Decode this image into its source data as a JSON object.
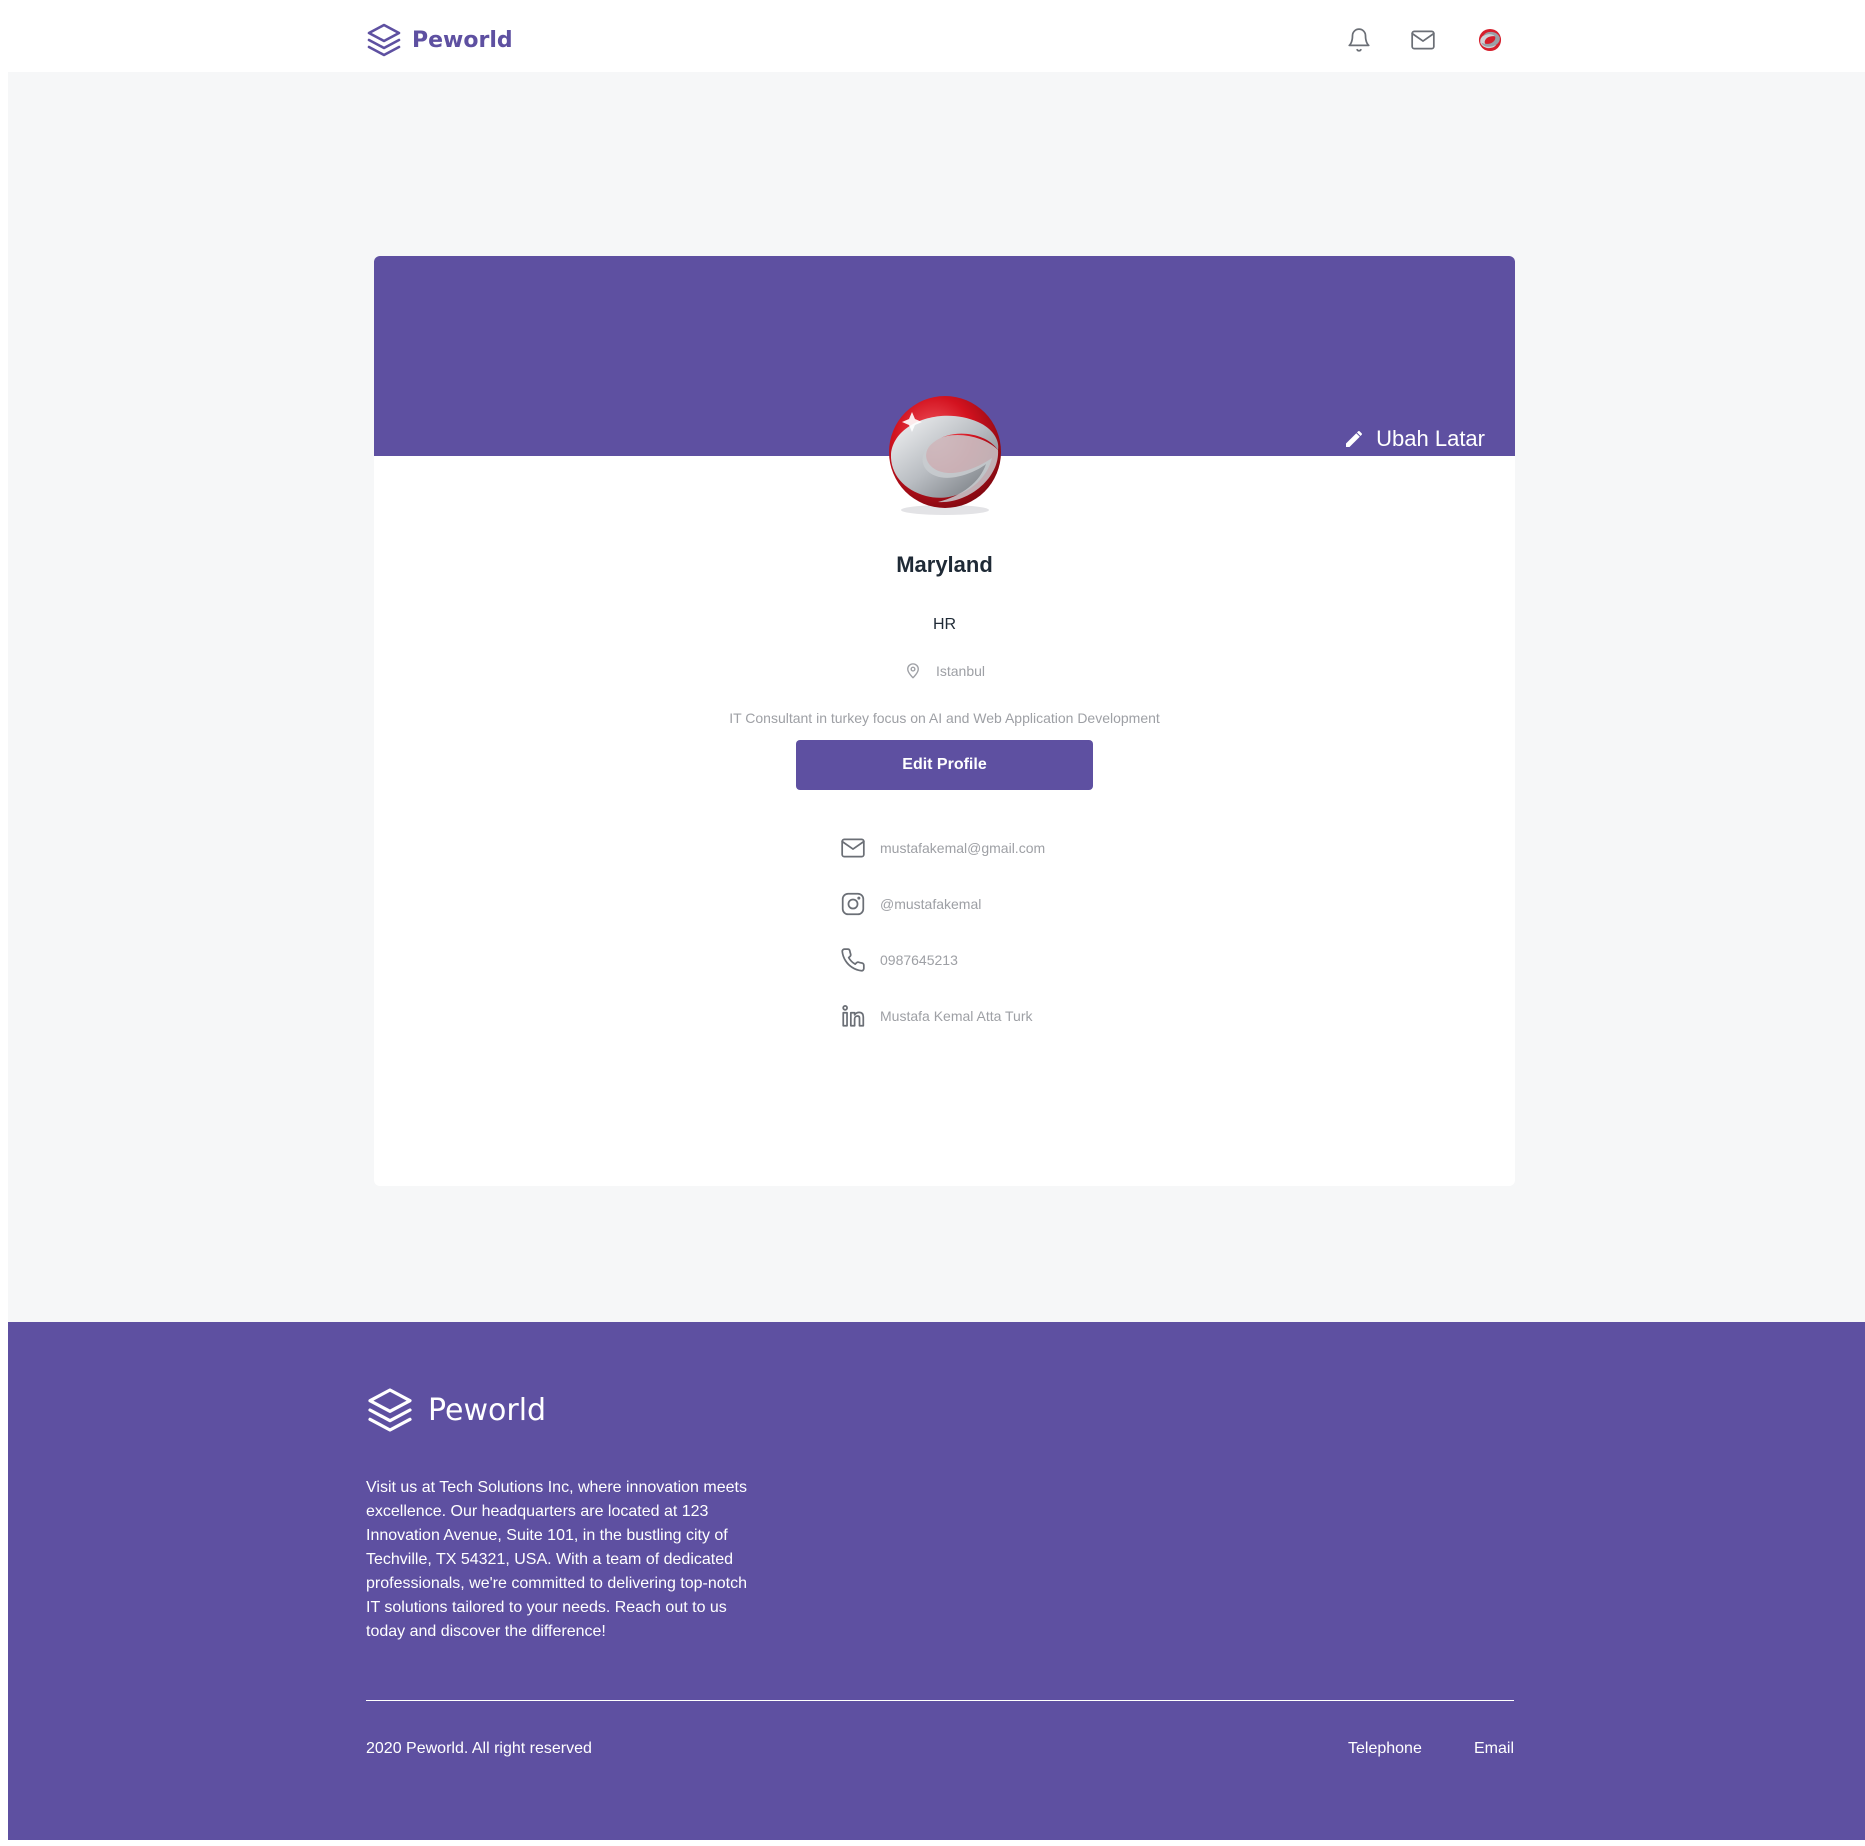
{
  "header": {
    "brand": "Peworld",
    "icons": [
      "bell-icon",
      "mail-icon",
      "avatar"
    ]
  },
  "profile": {
    "banner_edit_label": "Ubah Latar",
    "name": "Maryland",
    "role": "HR",
    "location": "Istanbul",
    "description": "IT Consultant in turkey focus on AI and Web Application Development",
    "edit_button_label": "Edit Profile",
    "contacts": {
      "email": "mustafakemal@gmail.com",
      "instagram": "@mustafakemal",
      "phone": "0987645213",
      "linkedin": "Mustafa Kemal Atta Turk"
    }
  },
  "footer": {
    "brand": "Peworld",
    "about": "Visit us at Tech Solutions Inc, where innovation meets excellence. Our headquarters are located at 123 Innovation Avenue, Suite 101, in the bustling city of Techville, TX 54321, USA. With a team of dedicated professionals, we're committed to delivering top-notch IT solutions tailored to your needs. Reach out to us today and discover the difference!",
    "copyright": "2020 Peworld. All right reserved",
    "links": [
      "Telephone",
      "Email"
    ]
  },
  "colors": {
    "brand": "#5e50a1",
    "background": "#f6f7f8",
    "muted_text": "#9ea0a5",
    "dark_text": "#1f2a36"
  }
}
